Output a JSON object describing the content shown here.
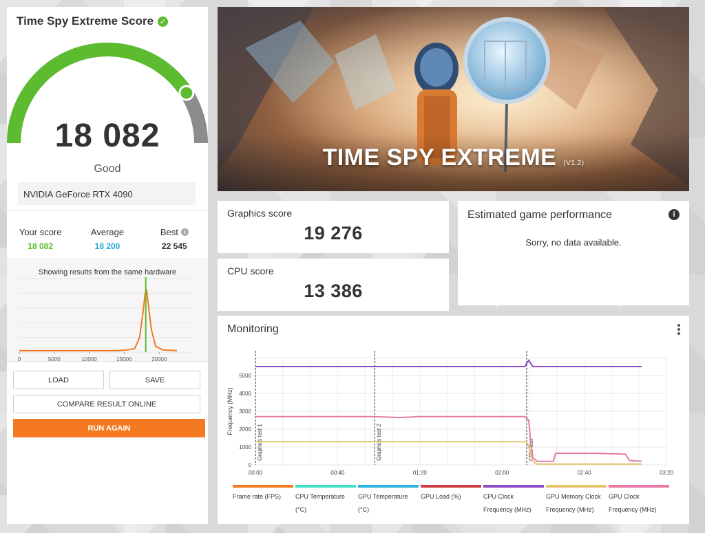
{
  "score_panel": {
    "title": "Time Spy Extreme Score",
    "score": "18 082",
    "rating": "Good",
    "gpu": "NVIDIA GeForce RTX 4090",
    "gauge_fraction": 0.82,
    "stats": [
      {
        "label": "Your score",
        "value": "18 082",
        "color": "#5dbb2f"
      },
      {
        "label": "Average",
        "value": "18 200",
        "color": "#2aa8d8"
      },
      {
        "label": "Best",
        "value": "22 545",
        "color": "#333333"
      }
    ],
    "histogram": {
      "caption": "Showing results from the same hardware",
      "x_ticks": [
        "0",
        "5000",
        "10000",
        "15000",
        "20000"
      ],
      "your_score": 18082,
      "xlim": [
        0,
        25000
      ],
      "curve": [
        [
          0,
          0.02
        ],
        [
          5000,
          0.02
        ],
        [
          10000,
          0.02
        ],
        [
          14000,
          0.02
        ],
        [
          15500,
          0.03
        ],
        [
          16500,
          0.05
        ],
        [
          17200,
          0.2
        ],
        [
          17700,
          0.55
        ],
        [
          18000,
          0.8
        ],
        [
          18200,
          0.85
        ],
        [
          18500,
          0.6
        ],
        [
          18900,
          0.3
        ],
        [
          19500,
          0.08
        ],
        [
          20500,
          0.03
        ],
        [
          22545,
          0.02
        ]
      ]
    },
    "buttons": {
      "load": "LOAD",
      "save": "SAVE",
      "compare": "COMPARE RESULT ONLINE",
      "run_again": "RUN AGAIN"
    }
  },
  "hero": {
    "title": "TIME SPY EXTREME",
    "version": "(V1.2)"
  },
  "graphics": {
    "label": "Graphics score",
    "value": "19 276"
  },
  "cpu": {
    "label": "CPU score",
    "value": "13 386"
  },
  "estimated": {
    "title": "Estimated game performance",
    "message": "Sorry, no data available."
  },
  "monitoring": {
    "title": "Monitoring",
    "y_axis_label": "Frequency (MHz)",
    "y_ticks": [
      "0",
      "1000",
      "2000",
      "3000",
      "4000",
      "5000"
    ],
    "x_ticks": [
      "00:00",
      "00:40",
      "01:20",
      "02:00",
      "02:40",
      "03:20"
    ],
    "markers": [
      {
        "label": "Graphics test 1",
        "t": 0
      },
      {
        "label": "Graphics test 2",
        "t": 58
      },
      {
        "label": "CPU test",
        "t": 132
      }
    ],
    "legend": [
      {
        "label": "Frame rate (FPS)",
        "color": "#f47920"
      },
      {
        "label": "CPU Temperature (°C)",
        "color": "#3fe0c5"
      },
      {
        "label": "GPU Temperature (°C)",
        "color": "#2ab0e0"
      },
      {
        "label": "GPU Load (%)",
        "color": "#d03a3a"
      },
      {
        "label": "CPU Clock Frequency (MHz)",
        "color": "#8a4cc4"
      },
      {
        "label": "GPU Memory Clock Frequency (MHz)",
        "color": "#e6c46e"
      },
      {
        "label": "GPU Clock Frequency (MHz)",
        "color": "#e77aa6"
      }
    ],
    "chart_data": {
      "type": "line",
      "xlabel": "",
      "ylabel": "Frequency (MHz)",
      "xlim": [
        0,
        200
      ],
      "ylim": [
        0,
        6000
      ],
      "series": [
        {
          "name": "CPU Clock Frequency (MHz)",
          "color": "#8a4cc4",
          "points": [
            [
              0,
              5500
            ],
            [
              131,
              5500
            ],
            [
              133,
              5850
            ],
            [
              135,
              5500
            ],
            [
              188,
              5500
            ]
          ]
        },
        {
          "name": "GPU Memory Clock Frequency (MHz)",
          "color": "#e6c46e",
          "points": [
            [
              0,
              1300
            ],
            [
              132,
              1300
            ],
            [
              133,
              1000
            ],
            [
              135,
              200
            ],
            [
              137,
              50
            ],
            [
              188,
              50
            ]
          ]
        },
        {
          "name": "GPU Clock Frequency (MHz)",
          "color": "#e77aa6",
          "points": [
            [
              0,
              2700
            ],
            [
              58,
              2700
            ],
            [
              70,
              2650
            ],
            [
              80,
              2700
            ],
            [
              131,
              2700
            ],
            [
              132,
              2600
            ],
            [
              133,
              2500
            ],
            [
              134,
              1200
            ],
            [
              135,
              400
            ],
            [
              137,
              200
            ],
            [
              145,
              200
            ],
            [
              146,
              650
            ],
            [
              166,
              650
            ],
            [
              180,
              600
            ],
            [
              182,
              250
            ],
            [
              188,
              200
            ]
          ]
        }
      ]
    }
  }
}
